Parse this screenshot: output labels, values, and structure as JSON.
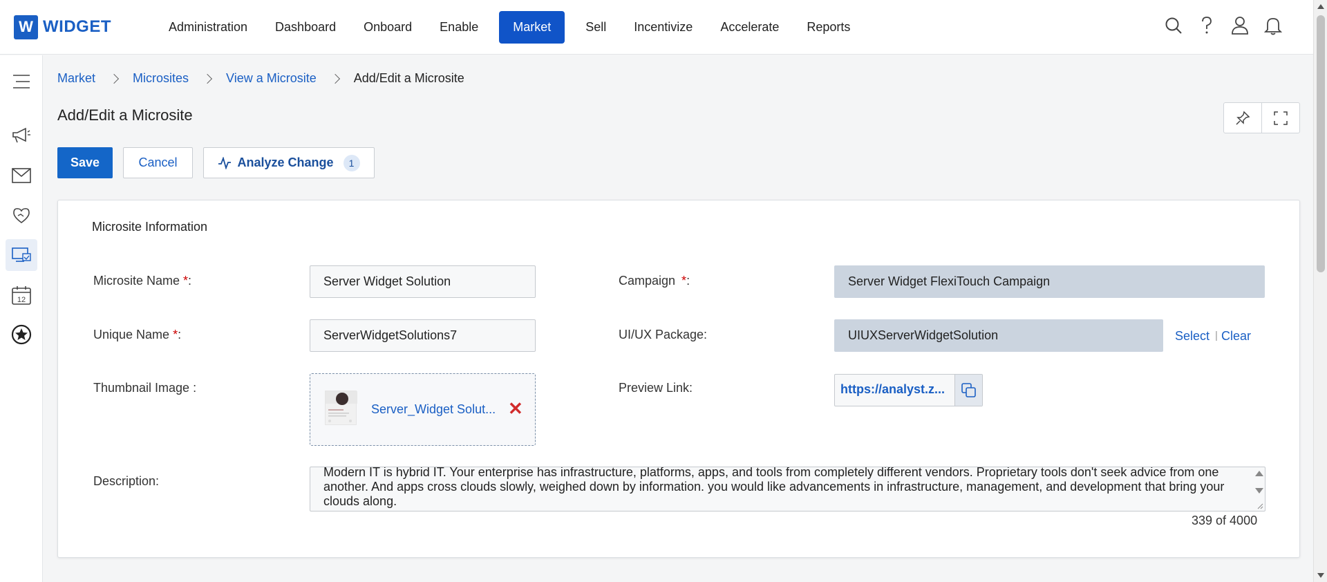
{
  "brand": {
    "badge": "W",
    "name": "WIDGET"
  },
  "nav": {
    "items": [
      {
        "label": "Administration",
        "active": false
      },
      {
        "label": "Dashboard",
        "active": false
      },
      {
        "label": "Onboard",
        "active": false
      },
      {
        "label": "Enable",
        "active": false
      },
      {
        "label": "Market",
        "active": true
      },
      {
        "label": "Sell",
        "active": false
      },
      {
        "label": "Incentivize",
        "active": false
      },
      {
        "label": "Accelerate",
        "active": false
      },
      {
        "label": "Reports",
        "active": false
      }
    ],
    "icons": [
      "search-icon",
      "help-icon",
      "user-icon",
      "bell-icon"
    ]
  },
  "sidebar": {
    "icons": [
      "menu-icon",
      "megaphone-icon",
      "envelope-icon",
      "handshake-icon",
      "microsite-icon",
      "calendar-icon",
      "star-badge-icon"
    ],
    "calendar_day": "12",
    "active_index": 4
  },
  "breadcrumb": {
    "items": [
      "Market",
      "Microsites",
      "View a Microsite"
    ],
    "current": "Add/Edit a Microsite"
  },
  "page": {
    "title": "Add/Edit a Microsite"
  },
  "toolbar": {
    "save_label": "Save",
    "cancel_label": "Cancel",
    "analyze_label": "Analyze Change",
    "analyze_count": "1"
  },
  "card": {
    "title": "Microsite Information",
    "microsite_name": {
      "label": "Microsite Name ",
      "req": "*",
      "suffix": ":",
      "value": "Server Widget Solution"
    },
    "unique_name": {
      "label": "Unique Name ",
      "req": "*",
      "suffix": ":",
      "value": "ServerWidgetSolutions7"
    },
    "thumbnail": {
      "label": "Thumbnail Image :",
      "file_name": "Server_Widget Solut...",
      "remove": "✕"
    },
    "campaign": {
      "label": "Campaign ",
      "req": "*",
      "suffix": ":",
      "value": "Server Widget FlexiTouch Campaign"
    },
    "uiux": {
      "label": "UI/UX Package:",
      "value": "UIUXServerWidgetSolution",
      "select": "Select",
      "sep": "|",
      "clear": "Clear"
    },
    "preview": {
      "label": "Preview Link:",
      "value": "https://analyst.z..."
    },
    "description": {
      "label": "Description:",
      "value": "Modern IT is hybrid IT. Your enterprise has infrastructure, platforms, apps, and tools from completely different vendors. Proprietary tools don't seek advice from one another. And apps cross clouds slowly, weighed down by information. you would like advancements in infrastructure, management, and development that bring your clouds along.",
      "count": "339 of 4000"
    }
  },
  "colors": {
    "primary": "#1466c8",
    "link": "#1a5fc4",
    "readonly": "#cbd4df",
    "danger": "#d12b2b"
  }
}
